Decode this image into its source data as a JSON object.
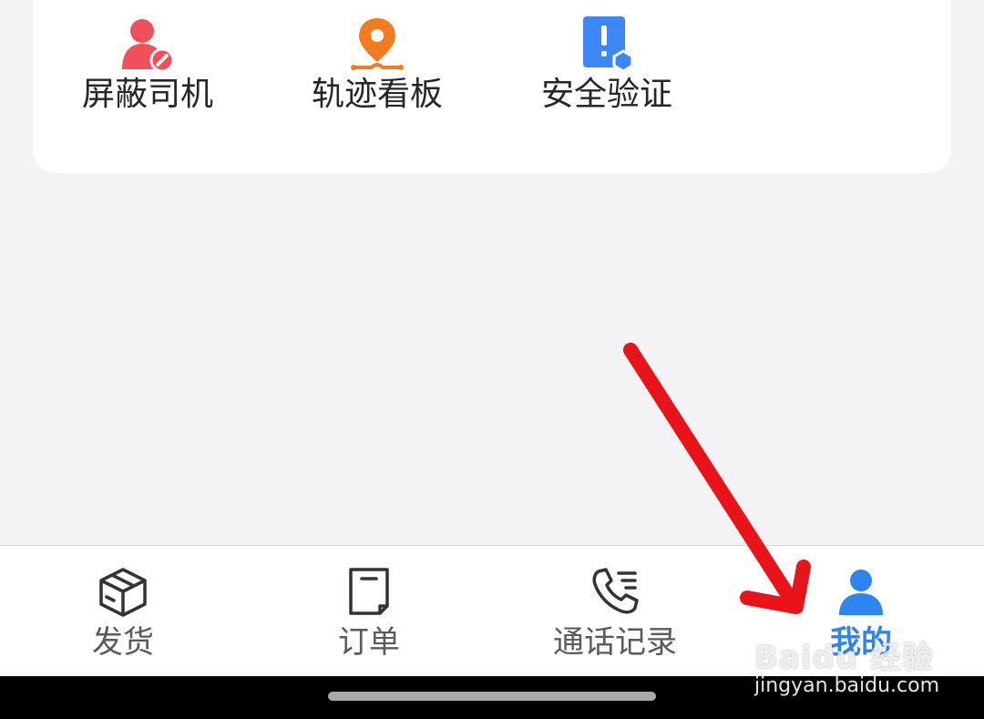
{
  "tools": [
    {
      "label": "屏蔽司机",
      "icon": "block-driver-icon",
      "color": "#f0505a"
    },
    {
      "label": "轨迹看板",
      "icon": "track-pin-icon",
      "color": "#f47c20"
    },
    {
      "label": "安全验证",
      "icon": "safety-check-icon",
      "color": "#3d86f5"
    }
  ],
  "tabbar": {
    "tabs": [
      {
        "label": "发货",
        "icon": "package-icon",
        "active": false
      },
      {
        "label": "订单",
        "icon": "order-icon",
        "active": false
      },
      {
        "label": "通话记录",
        "icon": "call-log-icon",
        "active": false
      },
      {
        "label": "我的",
        "icon": "person-icon",
        "active": true
      }
    ]
  },
  "colors": {
    "accent": "#2f85f0",
    "arrow": "#e8141a"
  },
  "watermark": {
    "logo": "Baidu 经验",
    "url": "jingyan.baidu.com"
  }
}
